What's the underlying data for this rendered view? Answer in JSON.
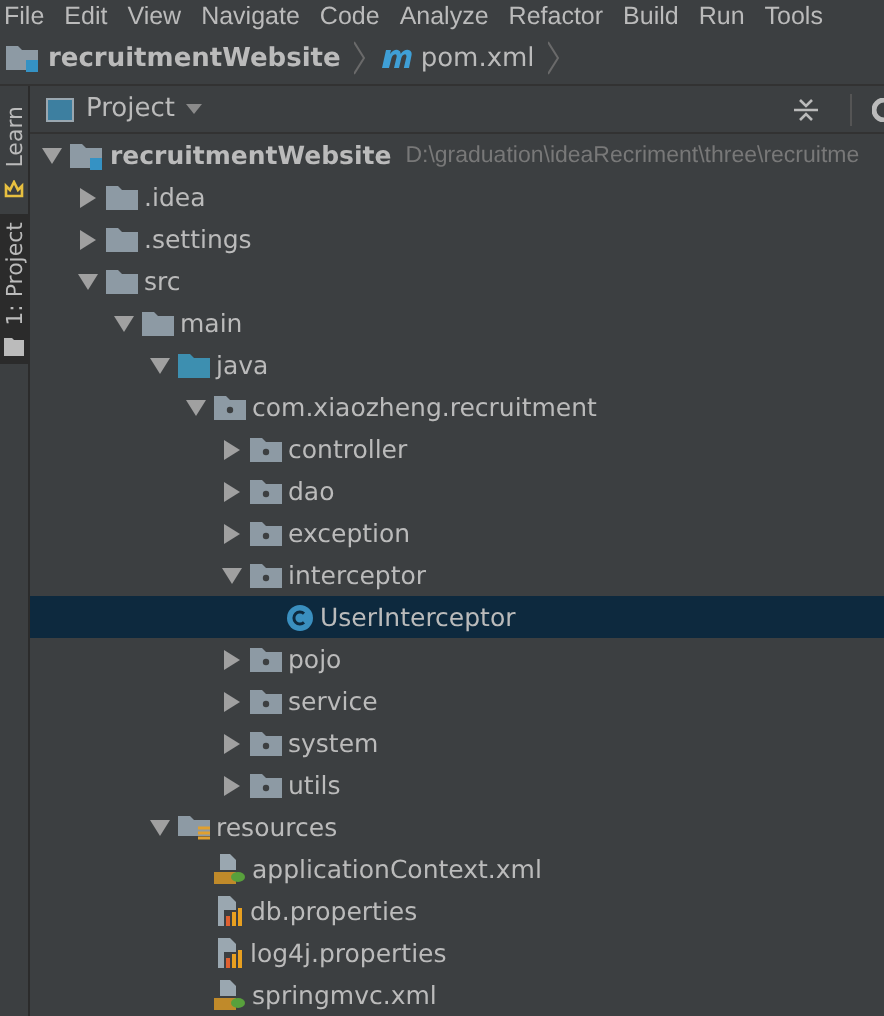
{
  "menu": [
    "File",
    "Edit",
    "View",
    "Navigate",
    "Code",
    "Analyze",
    "Refactor",
    "Build",
    "Run",
    "Tools"
  ],
  "breadcrumb": [
    {
      "label": "recruitmentWebsite",
      "kind": "module"
    },
    {
      "label": "pom.xml",
      "kind": "maven"
    }
  ],
  "side_stripe": [
    {
      "label": "Learn",
      "selected": false
    },
    {
      "label": "1: Project",
      "selected": true
    }
  ],
  "panel": {
    "title": "Project"
  },
  "tree": [
    {
      "label": "recruitmentWebsite",
      "path": "D:\\graduation\\ideaRecriment\\three\\recruitme",
      "kind": "module",
      "expanded": true,
      "selected": false,
      "children": [
        {
          "label": ".idea",
          "kind": "folder",
          "expanded": false,
          "selected": false
        },
        {
          "label": ".settings",
          "kind": "folder",
          "expanded": false,
          "selected": false
        },
        {
          "label": "src",
          "kind": "folder",
          "expanded": true,
          "selected": false,
          "children": [
            {
              "label": "main",
              "kind": "folder",
              "expanded": true,
              "selected": false,
              "children": [
                {
                  "label": "java",
                  "kind": "source",
                  "expanded": true,
                  "selected": false,
                  "children": [
                    {
                      "label": "com.xiaozheng.recruitment",
                      "kind": "package",
                      "expanded": true,
                      "selected": false,
                      "children": [
                        {
                          "label": "controller",
                          "kind": "package",
                          "expanded": false,
                          "selected": false
                        },
                        {
                          "label": "dao",
                          "kind": "package",
                          "expanded": false,
                          "selected": false
                        },
                        {
                          "label": "exception",
                          "kind": "package",
                          "expanded": false,
                          "selected": false
                        },
                        {
                          "label": "interceptor",
                          "kind": "package",
                          "expanded": true,
                          "selected": false,
                          "children": [
                            {
                              "label": "UserInterceptor",
                              "kind": "class",
                              "selected": true
                            }
                          ]
                        },
                        {
                          "label": "pojo",
                          "kind": "package",
                          "expanded": false,
                          "selected": false
                        },
                        {
                          "label": "service",
                          "kind": "package",
                          "expanded": false,
                          "selected": false
                        },
                        {
                          "label": "system",
                          "kind": "package",
                          "expanded": false,
                          "selected": false
                        },
                        {
                          "label": "utils",
                          "kind": "package",
                          "expanded": false,
                          "selected": false
                        }
                      ]
                    }
                  ]
                },
                {
                  "label": "resources",
                  "kind": "resources",
                  "expanded": true,
                  "selected": false,
                  "children": [
                    {
                      "label": "applicationContext.xml",
                      "kind": "xml",
                      "selected": false
                    },
                    {
                      "label": "db.properties",
                      "kind": "properties",
                      "selected": false
                    },
                    {
                      "label": "log4j.properties",
                      "kind": "properties",
                      "selected": false
                    },
                    {
                      "label": "springmvc.xml",
                      "kind": "xml",
                      "selected": false
                    }
                  ]
                }
              ]
            }
          ]
        }
      ]
    }
  ]
}
